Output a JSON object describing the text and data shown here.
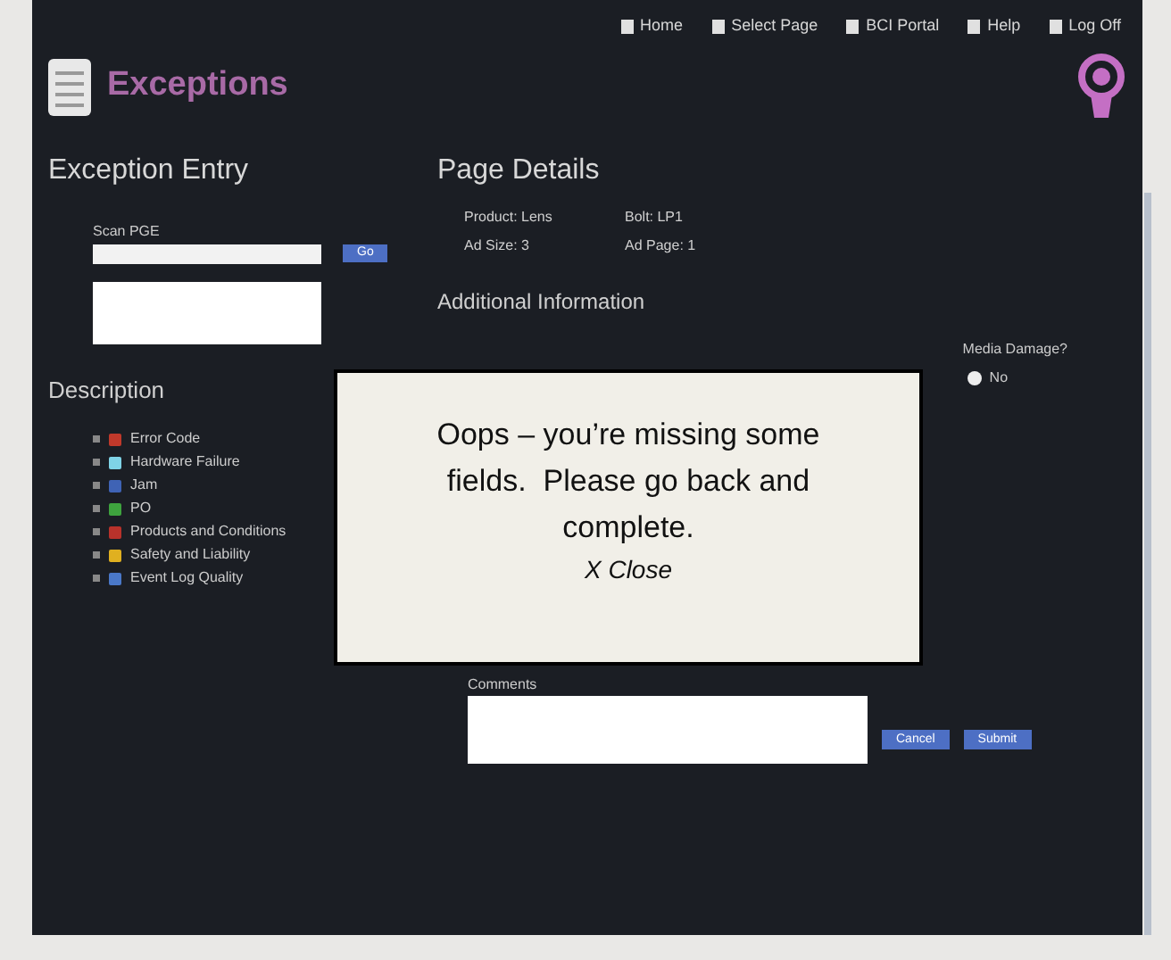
{
  "nav": [
    {
      "label": "Home"
    },
    {
      "label": "Select Page"
    },
    {
      "label": "BCI Portal"
    },
    {
      "label": "Help"
    },
    {
      "label": "Log Off"
    }
  ],
  "app": {
    "title": "Exceptions"
  },
  "entry": {
    "heading": "Exception Entry",
    "scan_label": "Scan PGE",
    "button": "Go"
  },
  "description": {
    "heading": "Description",
    "items": [
      {
        "label": "Error Code",
        "color": "#c0392b"
      },
      {
        "label": "Hardware Failure",
        "color": "#7fd3e6"
      },
      {
        "label": "Jam",
        "color": "#3f63b5"
      },
      {
        "label": "PO",
        "color": "#3ea33e"
      },
      {
        "label": "Products and Conditions",
        "color": "#b8322b"
      },
      {
        "label": "Safety and Liability",
        "color": "#e0b020"
      },
      {
        "label": "Event Log Quality",
        "color": "#4a78c8"
      }
    ]
  },
  "page_details": {
    "heading": "Page Details",
    "fields": [
      {
        "label": "Product:",
        "value": "Lens"
      },
      {
        "label": "Bolt:",
        "value": "LP1"
      },
      {
        "label": "Ad Size:",
        "value": "3"
      },
      {
        "label": "Ad Page:",
        "value": "1"
      }
    ]
  },
  "additional": {
    "heading": "Additional Information",
    "question": "Media Damage?",
    "option": {
      "label": "No",
      "selected": true
    }
  },
  "comments": {
    "label": "Comments",
    "buttons": [
      "Cancel",
      "Submit"
    ]
  },
  "modal": {
    "message": "Oops – you’re missing some fields.  Please go back and complete.",
    "close": "X Close"
  }
}
